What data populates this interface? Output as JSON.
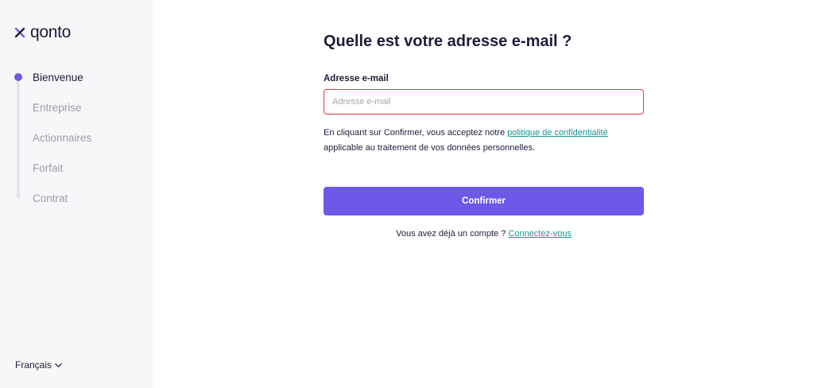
{
  "sidebar": {
    "logo": "qonto",
    "steps": [
      {
        "label": "Bienvenue",
        "active": true
      },
      {
        "label": "Entreprise",
        "active": false
      },
      {
        "label": "Actionnaires",
        "active": false
      },
      {
        "label": "Forfait",
        "active": false
      },
      {
        "label": "Contrat",
        "active": false
      }
    ],
    "language": "Français"
  },
  "main": {
    "title": "Quelle est votre adresse e-mail ?",
    "email_label": "Adresse e-mail",
    "email_placeholder": "Adresse e-mail",
    "email_value": "",
    "consent_prefix": "En cliquant sur Confirmer, vous acceptez notre ",
    "consent_link": "politique de confidentialité",
    "consent_suffix": "applicable au traitement de vos données personnelles.",
    "confirm_label": "Confirmer",
    "login_prompt": "Vous avez déjà un compte ?",
    "login_link": "Connectez-vous"
  },
  "colors": {
    "accent": "#6b5ae8",
    "link": "#16958f",
    "error_border": "#e0393e",
    "sidebar_bg": "#f7f7f9"
  },
  "icons": {
    "logo": "qonto-x-icon",
    "language_dropdown": "chevron-down-icon"
  }
}
